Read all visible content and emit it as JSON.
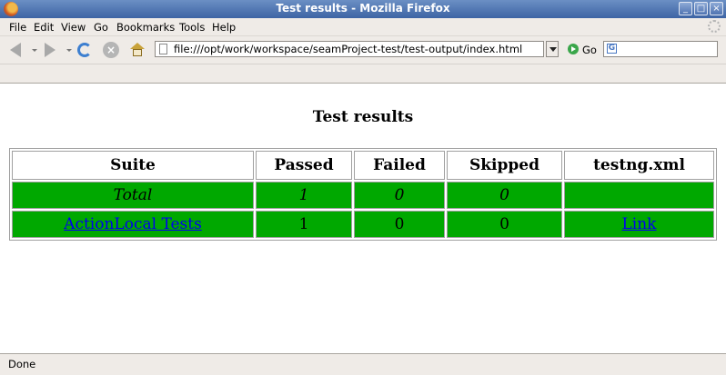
{
  "window": {
    "title": "Test results - Mozilla Firefox"
  },
  "menubar": {
    "items": [
      "File",
      "Edit",
      "View",
      "Go",
      "Bookmarks",
      "Tools",
      "Help"
    ]
  },
  "toolbar": {
    "url": "file:///opt/work/workspace/seamProject-test/test-output/index.html",
    "go_label": "Go",
    "search_value": ""
  },
  "page": {
    "heading": "Test results",
    "columns": [
      "Suite",
      "Passed",
      "Failed",
      "Skipped",
      "testng.xml"
    ],
    "rows": [
      {
        "suite": "Total",
        "passed": "1",
        "failed": "0",
        "skipped": "0",
        "xml": ""
      },
      {
        "suite": "ActionLocal Tests",
        "passed": "1",
        "failed": "0",
        "skipped": "0",
        "xml": "Link"
      }
    ],
    "row_color": "#00a800"
  },
  "status": {
    "text": "Done"
  },
  "icons": [
    "firefox-logo-icon",
    "back-icon",
    "forward-icon",
    "reload-icon",
    "stop-icon",
    "home-icon",
    "page-icon",
    "go-icon",
    "google-search-icon",
    "throbber-icon"
  ]
}
